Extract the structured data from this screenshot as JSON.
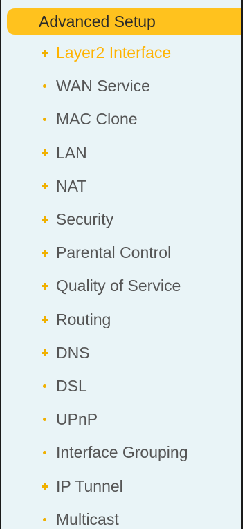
{
  "header": {
    "title": "Advanced Setup"
  },
  "colors": {
    "header_bg": "#ffc21e",
    "panel_bg": "#e9f4f7",
    "item_text": "#555555",
    "active_text": "#ffb300",
    "marker": "#f0b000"
  },
  "menu": {
    "items": [
      {
        "label": "Layer2 Interface",
        "marker": "plus-icon",
        "active": true
      },
      {
        "label": "WAN Service",
        "marker": "bullet-icon"
      },
      {
        "label": "MAC Clone",
        "marker": "bullet-icon"
      },
      {
        "label": "LAN",
        "marker": "plus-icon"
      },
      {
        "label": "NAT",
        "marker": "plus-icon"
      },
      {
        "label": "Security",
        "marker": "plus-icon"
      },
      {
        "label": "Parental Control",
        "marker": "plus-icon"
      },
      {
        "label": "Quality of Service",
        "marker": "plus-icon"
      },
      {
        "label": "Routing",
        "marker": "plus-icon"
      },
      {
        "label": "DNS",
        "marker": "plus-icon"
      },
      {
        "label": "DSL",
        "marker": "bullet-icon"
      },
      {
        "label": "UPnP",
        "marker": "bullet-icon"
      },
      {
        "label": "Interface Grouping",
        "marker": "bullet-icon"
      },
      {
        "label": "IP Tunnel",
        "marker": "plus-icon"
      },
      {
        "label": "Multicast",
        "marker": "bullet-icon"
      }
    ]
  }
}
